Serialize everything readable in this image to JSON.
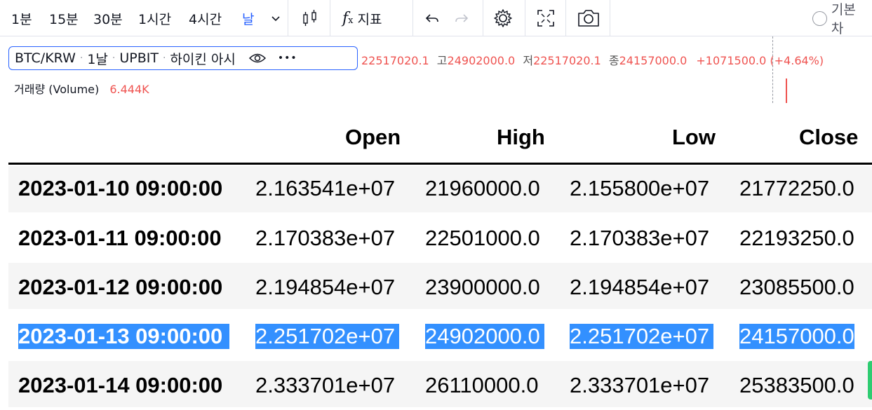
{
  "toolbar": {
    "intervals": [
      "1분",
      "15분",
      "30분",
      "1시간",
      "4시간",
      "날"
    ],
    "indicators_label": "지표",
    "layout_label": "기본 차",
    "active_color": "#2962ff"
  },
  "legend": {
    "symbol": "BTC/KRW",
    "interval": "1날",
    "exchange": "UPBIT",
    "chart_type": "하이킨 아시",
    "more": "•••",
    "open_value": "22517020.1",
    "high_label": "고",
    "high_value": "24902000.0",
    "low_label": "저",
    "low_value": "22517020.1",
    "close_label": "종",
    "close_value": "24157000.0",
    "change": "+1071500.0 (+4.64%)"
  },
  "volume": {
    "label": "거래량 (Volume)",
    "value": "6.444K"
  },
  "table": {
    "columns": [
      "Open",
      "High",
      "Low",
      "Close"
    ],
    "rows": [
      {
        "index": "2023-01-10 09:00:00",
        "open": "2.163541e+07",
        "high": "21960000.0",
        "low": "2.155800e+07",
        "close": "21772250.0"
      },
      {
        "index": "2023-01-11 09:00:00",
        "open": "2.170383e+07",
        "high": "22501000.0",
        "low": "2.170383e+07",
        "close": "22193250.0"
      },
      {
        "index": "2023-01-12 09:00:00",
        "open": "2.194854e+07",
        "high": "23900000.0",
        "low": "2.194854e+07",
        "close": "23085500.0"
      },
      {
        "index": "2023-01-13 09:00:00",
        "open": "2.251702e+07",
        "high": "24902000.0",
        "low": "2.251702e+07",
        "close": "24157000.0"
      },
      {
        "index": "2023-01-14 09:00:00",
        "open": "2.333701e+07",
        "high": "26110000.0",
        "low": "2.333701e+07",
        "close": "25383500.0"
      }
    ],
    "selected_row": 4,
    "selection_color": "#3390ff"
  }
}
